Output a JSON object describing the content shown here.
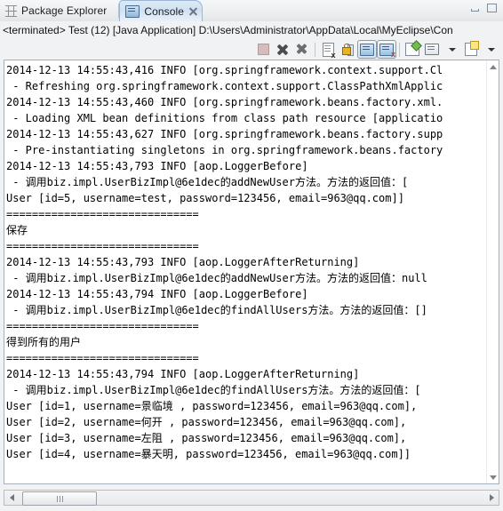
{
  "window": {
    "minimize_label": "Minimize",
    "maximize_label": "Maximize"
  },
  "tabs": [
    {
      "id": "package-explorer",
      "label": "Package Explorer",
      "icon": "package-icon",
      "active": false,
      "closable": false
    },
    {
      "id": "console",
      "label": "Console",
      "icon": "console-icon",
      "active": true,
      "closable": true
    }
  ],
  "launch_info": {
    "text": "<terminated> Test (12) [Java Application] D:\\Users\\Administrator\\AppData\\Local\\MyEclipse\\Con"
  },
  "toolbar": {
    "buttons": [
      {
        "id": "terminate",
        "label": "Terminate",
        "icon": "terminate-icon",
        "enabled": false,
        "pressed": false
      },
      {
        "id": "remove-launch",
        "label": "Remove Launch",
        "icon": "remove-launch-icon",
        "enabled": true,
        "pressed": false
      },
      {
        "id": "remove-all-terminated",
        "label": "Remove All Terminated Launches",
        "icon": "remove-all-icon",
        "enabled": true,
        "pressed": false
      },
      {
        "id": "clear-console",
        "label": "Clear Console",
        "icon": "clear-console-icon",
        "enabled": true,
        "pressed": false
      },
      {
        "id": "scroll-lock",
        "label": "Scroll Lock",
        "icon": "scroll-lock-icon",
        "enabled": true,
        "pressed": false
      },
      {
        "id": "show-console-on-output",
        "label": "Show Console When Standard Out Changes",
        "icon": "show-console-out-icon",
        "enabled": true,
        "pressed": true
      },
      {
        "id": "show-console-on-error",
        "label": "Show Console When Standard Error Changes",
        "icon": "show-console-err-icon",
        "enabled": true,
        "pressed": true
      },
      {
        "id": "pin-console",
        "label": "Pin Console",
        "icon": "pin-console-icon",
        "enabled": true,
        "pressed": false
      },
      {
        "id": "display-selected-console",
        "label": "Display Selected Console",
        "icon": "display-console-icon",
        "enabled": true,
        "pressed": false
      },
      {
        "id": "display-selected-console-menu",
        "label": "Display Selected Console Menu",
        "icon": "chevron-down-icon",
        "enabled": true,
        "pressed": false
      },
      {
        "id": "open-console",
        "label": "Open Console",
        "icon": "open-console-icon",
        "enabled": true,
        "pressed": false
      },
      {
        "id": "open-console-menu",
        "label": "Open Console Menu",
        "icon": "chevron-down-icon",
        "enabled": true,
        "pressed": false
      }
    ]
  },
  "console": {
    "lines": [
      "2014-12-13 14:55:43,416 INFO [org.springframework.context.support.Cl",
      " - Refreshing org.springframework.context.support.ClassPathXmlApplic",
      "2014-12-13 14:55:43,460 INFO [org.springframework.beans.factory.xml.",
      " - Loading XML bean definitions from class path resource [applicatio",
      "2014-12-13 14:55:43,627 INFO [org.springframework.beans.factory.supp",
      " - Pre-instantiating singletons in org.springframework.beans.factory",
      "2014-12-13 14:55:43,793 INFO [aop.LoggerBefore]",
      " - 调用biz.impl.UserBizImpl@6e1dec的addNewUser方法。方法的返回值：[",
      "User [id=5, username=test, password=123456, email=963@qq.com]]",
      "==============================",
      "保存",
      "==============================",
      "2014-12-13 14:55:43,793 INFO [aop.LoggerAfterReturning]",
      " - 调用biz.impl.UserBizImpl@6e1dec的addNewUser方法。方法的返回值：null",
      "2014-12-13 14:55:43,794 INFO [aop.LoggerBefore]",
      " - 调用biz.impl.UserBizImpl@6e1dec的findAllUsers方法。方法的返回值：[]",
      "==============================",
      "得到所有的用户",
      "==============================",
      "2014-12-13 14:55:43,794 INFO [aop.LoggerAfterReturning]",
      " - 调用biz.impl.UserBizImpl@6e1dec的findAllUsers方法。方法的返回值：[",
      "User [id=1, username=景临境 , password=123456, email=963@qq.com],",
      "User [id=2, username=何开 , password=123456, email=963@qq.com],",
      "User [id=3, username=左阻 , password=123456, email=963@qq.com],",
      "User [id=4, username=暴天明, password=123456, email=963@qq.com]]"
    ]
  },
  "scrollbars": {
    "vertical": {
      "up_label": "Scroll Up",
      "down_label": "Scroll Down"
    },
    "horizontal": {
      "left_label": "Scroll Left",
      "right_label": "Scroll Right",
      "thumb_label": "Horizontal Scroll Thumb"
    }
  },
  "colors": {
    "tab_active_border": "#9ab6d4",
    "console_bg": "#ffffff",
    "console_text": "#000000",
    "chrome_bg": "#f1f2f4"
  }
}
